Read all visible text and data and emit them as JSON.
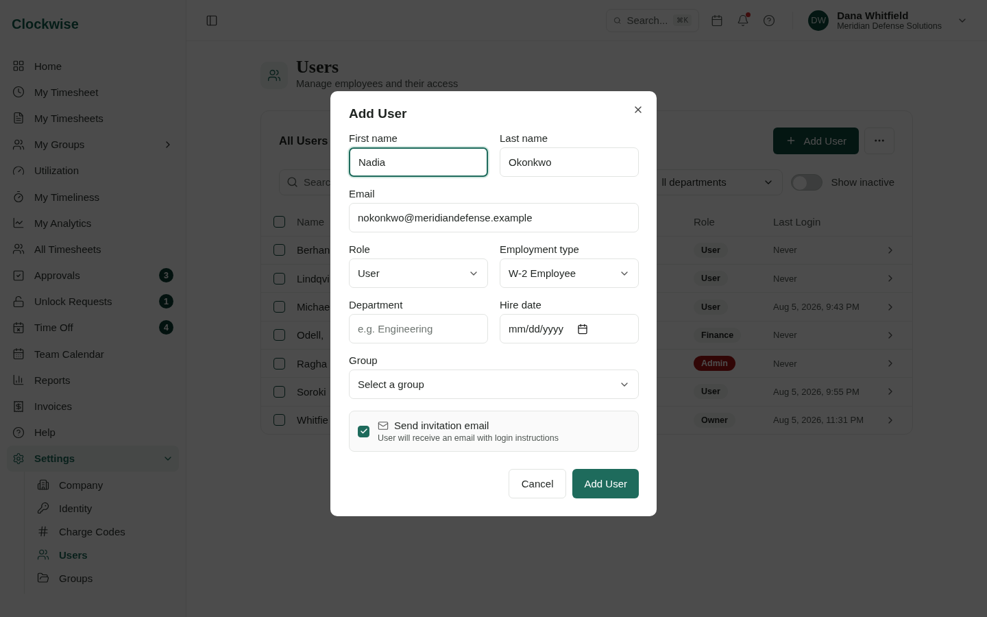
{
  "app": {
    "logo": "Clockwise"
  },
  "sidebar": {
    "items": [
      {
        "label": "Home",
        "selected": false
      },
      {
        "label": "My Timesheet",
        "selected": false
      },
      {
        "label": "My Timesheets",
        "selected": false
      },
      {
        "label": "My Groups",
        "selected": false,
        "expanded": false
      },
      {
        "label": "Utilization",
        "selected": false
      },
      {
        "label": "My Timeliness",
        "selected": false
      },
      {
        "label": "My Analytics",
        "selected": false
      },
      {
        "label": "All Timesheets",
        "selected": false
      },
      {
        "label": "Approvals",
        "selected": false,
        "badge": "3"
      },
      {
        "label": "Unlock Requests",
        "selected": false,
        "badge": "1"
      },
      {
        "label": "Time Off",
        "selected": false,
        "badge": "4"
      },
      {
        "label": "Team Calendar",
        "selected": false
      },
      {
        "label": "Reports",
        "selected": false
      },
      {
        "label": "Invoices",
        "selected": false
      },
      {
        "label": "Help",
        "selected": false
      },
      {
        "label": "Settings",
        "selected": true,
        "expanded": true,
        "children": [
          {
            "label": "Company",
            "selected": false
          },
          {
            "label": "Identity",
            "selected": false
          },
          {
            "label": "Charge Codes",
            "selected": false
          },
          {
            "label": "Users",
            "selected": true
          },
          {
            "label": "Groups",
            "selected": false
          }
        ]
      }
    ]
  },
  "topbar": {
    "search": {
      "placeholder": "Search...",
      "shortcut": "⌘K"
    },
    "notifications": true,
    "user": {
      "initials": "DW",
      "name": "Dana Whitfield",
      "company": "Meridian Defense Solutions"
    }
  },
  "page": {
    "title": "Users",
    "subtitle": "Manage employees and their access"
  },
  "card": {
    "title": "All Users",
    "add_button": "Add User",
    "search": {
      "placeholder": "Searc"
    },
    "department_filter": "ll departments",
    "show_inactive": {
      "label": "Show inactive",
      "on": false
    },
    "columns": [
      "Name",
      "Role",
      "Last Login"
    ],
    "select_all_checked": false,
    "rows": [
      {
        "name": "Berhan",
        "role": "User",
        "highlighted": false,
        "last_login": "Never",
        "checked": false
      },
      {
        "name": "Lindqvi",
        "role": "User",
        "highlighted": false,
        "last_login": "Never",
        "checked": false
      },
      {
        "name": "Michae",
        "role": "User",
        "highlighted": false,
        "last_login": "Aug 5, 2026, 9:43 PM",
        "checked": false
      },
      {
        "name": "Odell,",
        "role": "Finance",
        "highlighted": false,
        "last_login": "Never",
        "checked": false
      },
      {
        "name": "Ragha",
        "role": "Admin",
        "highlighted": true,
        "last_login": "Never",
        "checked": false
      },
      {
        "name": "Soroki",
        "role": "User",
        "highlighted": false,
        "last_login": "Aug 5, 2026, 9:55 PM",
        "checked": false
      },
      {
        "name": "Whitfie",
        "role": "Owner",
        "highlighted": false,
        "last_login": "Aug 5, 2026, 11:31 PM",
        "checked": false
      }
    ]
  },
  "dialog": {
    "title": "Add User",
    "first_name": {
      "label": "First name",
      "value": "Nadia",
      "focused": true
    },
    "last_name": {
      "label": "Last name",
      "value": "Okonkwo",
      "focused": false
    },
    "email": {
      "label": "Email",
      "value": "nokonkwo@meridiandefense.example"
    },
    "role": {
      "label": "Role",
      "value": "User"
    },
    "employment_type": {
      "label": "Employment type",
      "value": "W-2 Employee"
    },
    "department": {
      "label": "Department",
      "placeholder": "e.g. Engineering"
    },
    "hire_date": {
      "label": "Hire date",
      "placeholder": "mm/dd/yyyy"
    },
    "group": {
      "label": "Group",
      "value": "Select a group"
    },
    "invite": {
      "checked": true,
      "title": "Send invitation email",
      "description": "User will receive an email with login instructions"
    },
    "buttons": {
      "cancel": "Cancel",
      "submit": "Add User"
    }
  }
}
